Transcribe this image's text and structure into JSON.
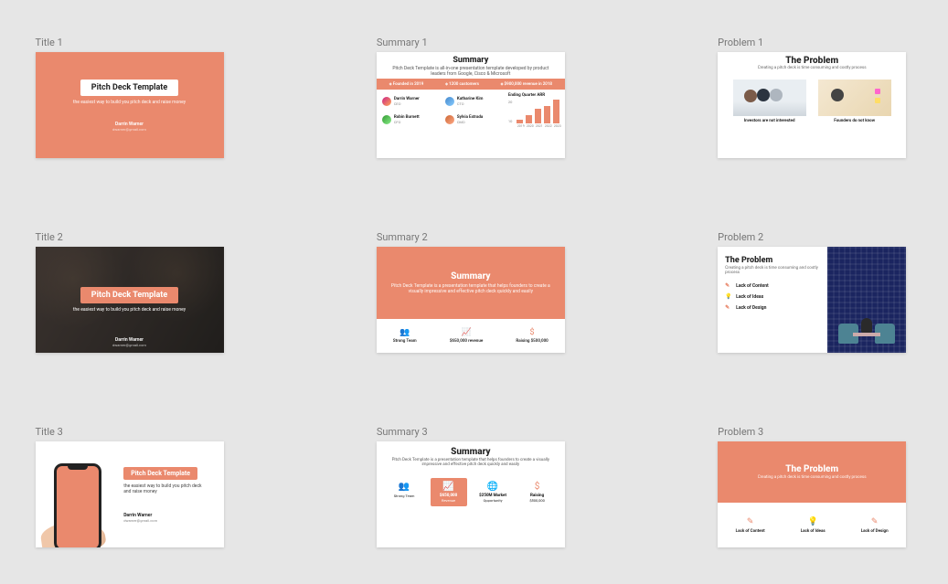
{
  "labels": {
    "title1": "Title 1",
    "title2": "Title 2",
    "title3": "Title 3",
    "summary1": "Summary 1",
    "summary2": "Summary 2",
    "summary3": "Summary 3",
    "problem1": "Problem 1",
    "problem2": "Problem 2",
    "problem3": "Problem 3"
  },
  "title1": {
    "heading": "Pitch Deck Template",
    "tagline": "the easiest way to build you pitch deck and raise money",
    "author": "Darrin Warner",
    "email": "dwarner@gmail.com"
  },
  "title2": {
    "heading": "Pitch Deck Template",
    "tagline": "the easiest way to build you pitch deck and raise money",
    "author": "Darrin Warner",
    "email": "dwarner@gmail.com"
  },
  "title3": {
    "heading": "Pitch Deck Template",
    "tagline": "the easiest way to build you pitch deck and raise money",
    "author": "Darrin Warner",
    "email": "dwarner@gmail.com"
  },
  "summary1": {
    "title": "Summary",
    "subtitle": "Pitch Deck Template is all-in-one presentation template developed by product leaders from Google, Cisco & Microsoft",
    "ribbon": {
      "a": "Founded in 2019",
      "b": "1200 customers",
      "c": "$900,000 revenue in 2018"
    },
    "people": [
      {
        "name": "Darrin Warner",
        "role": "CEO"
      },
      {
        "name": "Katharine Kim",
        "role": "CTO"
      },
      {
        "name": "Robin Burnett",
        "role": "CFO"
      },
      {
        "name": "Sylvia Estrada",
        "role": "CMO"
      }
    ],
    "chart_title": "Ending Quarter ARR"
  },
  "summary2": {
    "title": "Summary",
    "subtitle": "Pitch Deck Template is a presentation template that helps founders to create a visually impressive and effective pitch deck quickly and easily",
    "stats": {
      "a": "Strong Team",
      "b": "$650,000 revenue",
      "c": "Raising $500,000"
    }
  },
  "summary3": {
    "title": "Summary",
    "subtitle": "Pitch Deck Template is a presentation template that helps founders to create a visually impressive and effective pitch deck quickly and easily",
    "cards": [
      {
        "value": "",
        "label": "Strong Team"
      },
      {
        "value": "$650,000",
        "label": "Revenue"
      },
      {
        "value": "$250M Market",
        "label": "Opportunity"
      },
      {
        "value": "Raising",
        "label": "$500,000"
      }
    ]
  },
  "problem1": {
    "title": "The Problem",
    "subtitle": "Creating a pitch deck is time consuming and costly process",
    "caps": {
      "a": "Investors are not interested",
      "b": "Founders do not know"
    }
  },
  "problem2": {
    "title": "The Problem",
    "subtitle": "Creating a pitch deck is time consuming and costly process",
    "items": {
      "a": "Lack of Content",
      "b": "Lack of Ideas",
      "c": "Lack of Design"
    }
  },
  "problem3": {
    "title": "The Problem",
    "subtitle": "Creating a pitch deck is time consuming and costly process",
    "items": {
      "a": "Lack of Content",
      "b": "Lack of Ideas",
      "c": "Lack of Design"
    }
  },
  "chart_data": {
    "type": "bar",
    "title": "Ending Quarter ARR",
    "categories": [
      "2019",
      "2020",
      "2021",
      "2022",
      "2023"
    ],
    "values": [
      3,
      7,
      12,
      15,
      20
    ],
    "ylabel": "",
    "xlabel": "",
    "ylim": [
      0,
      20
    ],
    "y_ticks": [
      10,
      20
    ]
  }
}
